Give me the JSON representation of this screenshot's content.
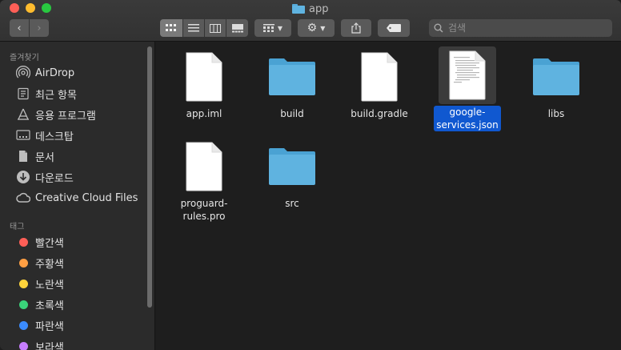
{
  "window": {
    "title": "app"
  },
  "search": {
    "placeholder": "검색"
  },
  "sidebar": {
    "favorites_header": "즐겨찾기",
    "favorites": [
      {
        "label": "AirDrop",
        "icon": "airdrop-icon"
      },
      {
        "label": "최근 항목",
        "icon": "recents-icon"
      },
      {
        "label": "응용 프로그램",
        "icon": "applications-icon"
      },
      {
        "label": "데스크탑",
        "icon": "desktop-icon"
      },
      {
        "label": "문서",
        "icon": "document-icon"
      },
      {
        "label": "다운로드",
        "icon": "downloads-icon"
      },
      {
        "label": "Creative Cloud Files",
        "icon": "creative-cloud-icon"
      }
    ],
    "tags_header": "태그",
    "tags": [
      {
        "label": "빨간색",
        "color": "#ff5f57"
      },
      {
        "label": "주황색",
        "color": "#ff9f43"
      },
      {
        "label": "노란색",
        "color": "#ffd43b"
      },
      {
        "label": "초록색",
        "color": "#3ad37a"
      },
      {
        "label": "파란색",
        "color": "#3b8cff"
      },
      {
        "label": "보라색",
        "color": "#c77dff"
      }
    ]
  },
  "files": [
    {
      "name": "app.iml",
      "kind": "document",
      "selected": false
    },
    {
      "name": "build",
      "kind": "folder",
      "selected": false
    },
    {
      "name": "build.gradle",
      "kind": "document",
      "selected": false
    },
    {
      "name": "google-services.json",
      "name_lines": [
        "google-",
        "services.json"
      ],
      "kind": "json-preview",
      "selected": true
    },
    {
      "name": "libs",
      "kind": "folder",
      "selected": false
    },
    {
      "name": "proguard-rules.pro",
      "name_lines": [
        "proguard-",
        "rules.pro"
      ],
      "kind": "document",
      "selected": false
    },
    {
      "name": "src",
      "kind": "folder",
      "selected": false
    }
  ],
  "colors": {
    "folder": "#5fb3e0",
    "folder_tab": "#4aa2d3",
    "selection": "#1058d0"
  }
}
